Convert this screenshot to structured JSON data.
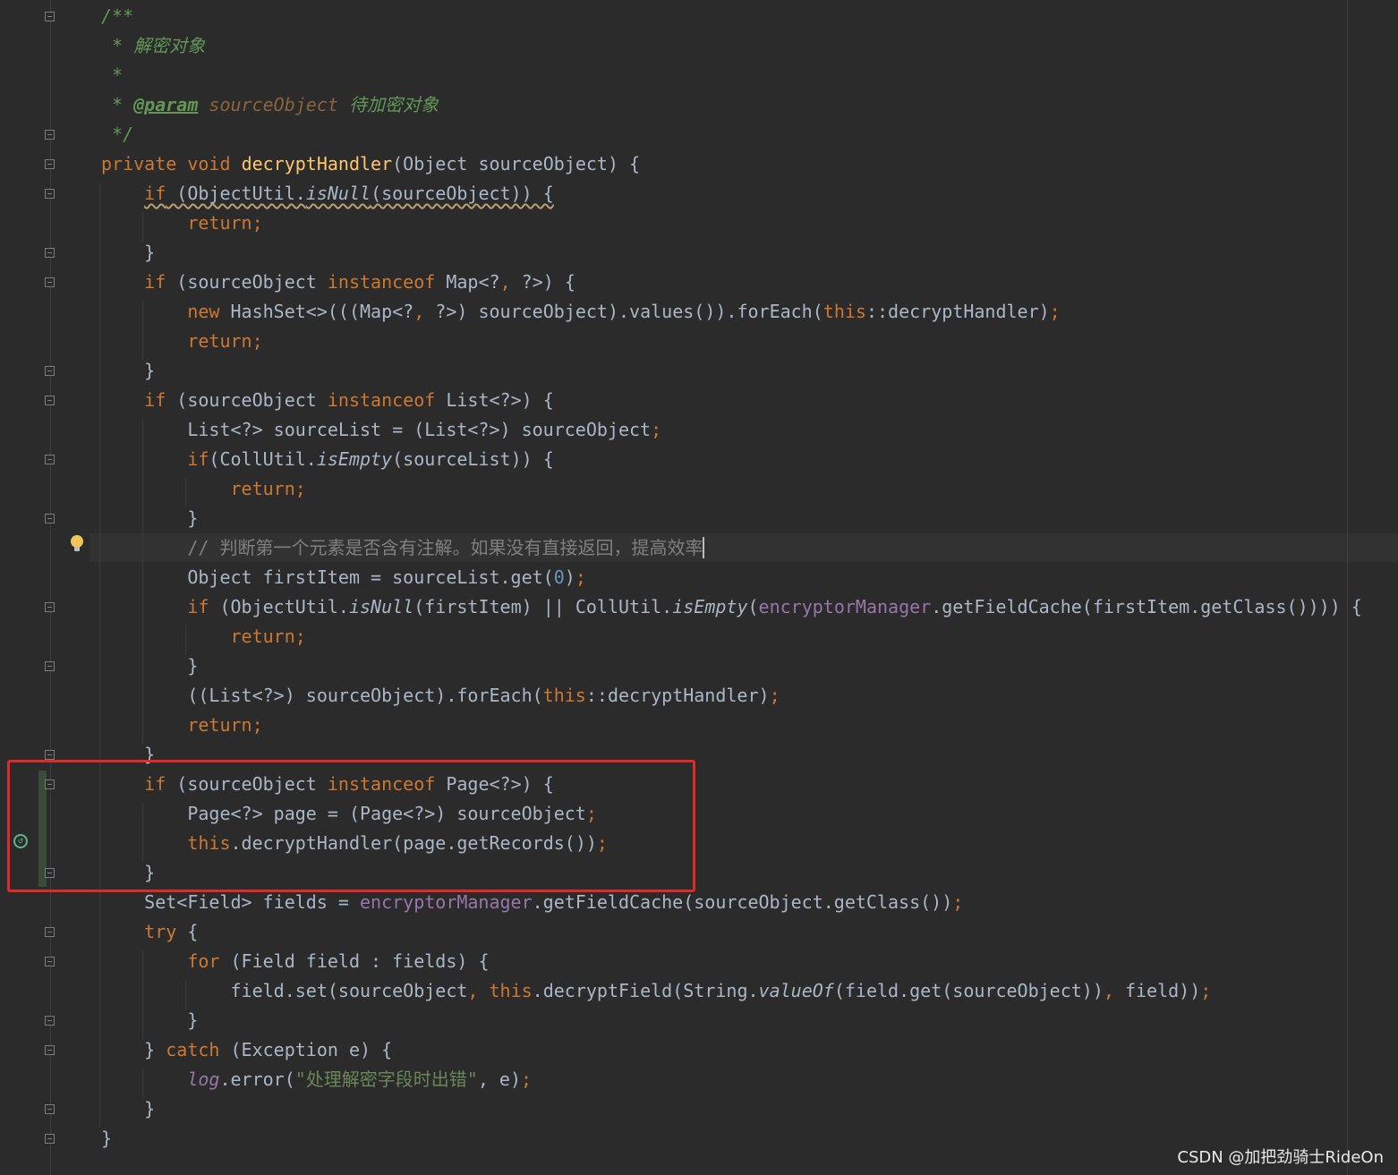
{
  "watermark": "CSDN @加把劲骑士RideOn",
  "lines": [
    [
      {
        "t": "/**",
        "c": "cm"
      }
    ],
    [
      {
        "t": " * 解密对象",
        "c": "cm"
      }
    ],
    [
      {
        "t": " *",
        "c": "cm"
      }
    ],
    [
      {
        "t": " * ",
        "c": "cm"
      },
      {
        "t": "@param",
        "c": "tag"
      },
      {
        "t": " sourceObject",
        "c": "pn"
      },
      {
        "t": " 待加密对象",
        "c": "cm"
      }
    ],
    [
      {
        "t": " */",
        "c": "cm"
      }
    ],
    [
      {
        "t": "private",
        "c": "kw"
      },
      {
        "t": " "
      },
      {
        "t": "void",
        "c": "kw"
      },
      {
        "t": " "
      },
      {
        "t": "decryptHandler",
        "c": "fn"
      },
      {
        "t": "(Object sourceObject) {"
      }
    ],
    [
      {
        "t": "    "
      },
      {
        "t": "if",
        "c": "kw squiggle"
      },
      {
        "t": " (ObjectUtil.",
        "c": "squiggle"
      },
      {
        "t": "isNull",
        "c": "it squiggle"
      },
      {
        "t": "(sourceObject)) {",
        "c": "squiggle"
      }
    ],
    [
      {
        "t": "        "
      },
      {
        "t": "return;",
        "c": "kw"
      }
    ],
    [
      {
        "t": "    }"
      }
    ],
    [
      {
        "t": "    "
      },
      {
        "t": "if",
        "c": "kw"
      },
      {
        "t": " (sourceObject "
      },
      {
        "t": "instanceof",
        "c": "kw"
      },
      {
        "t": " Map<?"
      },
      {
        "t": ",",
        "c": "kw"
      },
      {
        "t": " ?>) {"
      }
    ],
    [
      {
        "t": "        "
      },
      {
        "t": "new",
        "c": "kw"
      },
      {
        "t": " HashSet<>(((Map<?"
      },
      {
        "t": ",",
        "c": "kw"
      },
      {
        "t": " ?>) sourceObject).values()).forEach("
      },
      {
        "t": "this",
        "c": "kw"
      },
      {
        "t": "::decryptHandler)"
      },
      {
        "t": ";",
        "c": "kw"
      }
    ],
    [
      {
        "t": "        "
      },
      {
        "t": "return;",
        "c": "kw"
      }
    ],
    [
      {
        "t": "    }"
      }
    ],
    [
      {
        "t": "    "
      },
      {
        "t": "if",
        "c": "kw"
      },
      {
        "t": " (sourceObject "
      },
      {
        "t": "instanceof",
        "c": "kw"
      },
      {
        "t": " List<?>) {"
      }
    ],
    [
      {
        "t": "        List<?> sourceList = (List<?>) sourceObject"
      },
      {
        "t": ";",
        "c": "kw"
      }
    ],
    [
      {
        "t": "        "
      },
      {
        "t": "if",
        "c": "kw"
      },
      {
        "t": "(CollUtil."
      },
      {
        "t": "isEmpty",
        "c": "it"
      },
      {
        "t": "(sourceList)) {"
      }
    ],
    [
      {
        "t": "            "
      },
      {
        "t": "return;",
        "c": "kw"
      }
    ],
    [
      {
        "t": "        }"
      }
    ],
    [
      {
        "t": "        "
      },
      {
        "t": "// 判断第一个元素是否含有注解。如果没有直接返回，提高效率",
        "c": "lc"
      },
      {
        "caret": true
      }
    ],
    [
      {
        "t": "        Object firstItem = sourceList.get("
      },
      {
        "t": "0",
        "c": "num"
      },
      {
        "t": ")"
      },
      {
        "t": ";",
        "c": "kw"
      }
    ],
    [
      {
        "t": "        "
      },
      {
        "t": "if",
        "c": "kw"
      },
      {
        "t": " (ObjectUtil."
      },
      {
        "t": "isNull",
        "c": "it"
      },
      {
        "t": "(firstItem) || CollUtil."
      },
      {
        "t": "isEmpty",
        "c": "it"
      },
      {
        "t": "("
      },
      {
        "t": "encryptorManager",
        "c": "fld"
      },
      {
        "t": ".getFieldCache(firstItem.getClass()))) {"
      }
    ],
    [
      {
        "t": "            "
      },
      {
        "t": "return;",
        "c": "kw"
      }
    ],
    [
      {
        "t": "        }"
      }
    ],
    [
      {
        "t": "        ((List<?>) sourceObject).forEach("
      },
      {
        "t": "this",
        "c": "kw"
      },
      {
        "t": "::decryptHandler)"
      },
      {
        "t": ";",
        "c": "kw"
      }
    ],
    [
      {
        "t": "        "
      },
      {
        "t": "return;",
        "c": "kw"
      }
    ],
    [
      {
        "t": "    }"
      }
    ],
    [
      {
        "t": "    "
      },
      {
        "t": "if",
        "c": "kw"
      },
      {
        "t": " (sourceObject "
      },
      {
        "t": "instanceof",
        "c": "kw"
      },
      {
        "t": " Page<?>) {"
      }
    ],
    [
      {
        "t": "        Page<?> page = (Page<?>) sourceObject"
      },
      {
        "t": ";",
        "c": "kw"
      }
    ],
    [
      {
        "t": "        "
      },
      {
        "t": "this",
        "c": "kw"
      },
      {
        "t": ".decryptHandler(page.getRecords())"
      },
      {
        "t": ";",
        "c": "kw"
      }
    ],
    [
      {
        "t": "    }"
      }
    ],
    [
      {
        "t": "    Set<Field> fields = "
      },
      {
        "t": "encryptorManager",
        "c": "fld"
      },
      {
        "t": ".getFieldCache(sourceObject.getClass())"
      },
      {
        "t": ";",
        "c": "kw"
      }
    ],
    [
      {
        "t": "    "
      },
      {
        "t": "try",
        "c": "kw"
      },
      {
        "t": " {"
      }
    ],
    [
      {
        "t": "        "
      },
      {
        "t": "for",
        "c": "kw"
      },
      {
        "t": " (Field field : fields) {"
      }
    ],
    [
      {
        "t": "            field.set(sourceObject"
      },
      {
        "t": ",",
        "c": "kw"
      },
      {
        "t": " "
      },
      {
        "t": "this",
        "c": "kw"
      },
      {
        "t": ".decryptField(String."
      },
      {
        "t": "valueOf",
        "c": "it"
      },
      {
        "t": "(field.get(sourceObject))"
      },
      {
        "t": ",",
        "c": "kw"
      },
      {
        "t": " field))"
      },
      {
        "t": ";",
        "c": "kw"
      }
    ],
    [
      {
        "t": "        }"
      }
    ],
    [
      {
        "t": "    } "
      },
      {
        "t": "catch",
        "c": "kw"
      },
      {
        "t": " (Exception e) {"
      }
    ],
    [
      {
        "t": "        "
      },
      {
        "t": "log",
        "c": "fld it"
      },
      {
        "t": ".error("
      },
      {
        "t": "\"处理解密字段时出错\"",
        "c": "st"
      },
      {
        "t": ","
      },
      {
        "t": " e)"
      },
      {
        "t": ";",
        "c": "kw"
      }
    ],
    [
      {
        "t": "    }"
      }
    ],
    [
      {
        "t": "}"
      }
    ]
  ]
}
